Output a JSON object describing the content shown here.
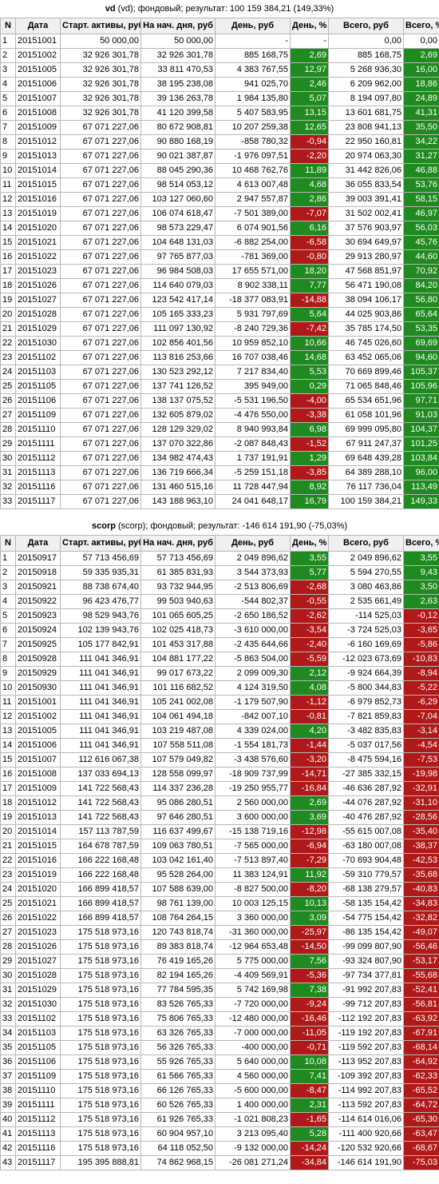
{
  "colors": {
    "positive": "#1f8a1f",
    "negative": "#b01919"
  },
  "headers": [
    "N",
    "Дата",
    "Старт. активы, руб",
    "На нач. дня, руб",
    "День, руб",
    "День, %",
    "Всего, руб",
    "Всего, %"
  ],
  "sections": [
    {
      "name": "vd",
      "title_rest": " (vd); фондовый; результат: 100 159 384,21 (149,33%)",
      "rows": [
        [
          "1",
          "20151001",
          "50 000,00",
          "50 000,00",
          "-",
          "-",
          "0,00",
          "0,00"
        ],
        [
          "2",
          "20151002",
          "32 926 301,78",
          "32 926 301,78",
          "885 168,75",
          "2,69",
          "885 168,75",
          "2,69"
        ],
        [
          "3",
          "20151005",
          "32 926 301,78",
          "33 811 470,53",
          "4 383 767,55",
          "12,97",
          "5 268 936,30",
          "16,00"
        ],
        [
          "4",
          "20151006",
          "32 926 301,78",
          "38 195 238,08",
          "941 025,70",
          "2,46",
          "6 209 962,00",
          "18,86"
        ],
        [
          "5",
          "20151007",
          "32 926 301,78",
          "39 136 263,78",
          "1 984 135,80",
          "5,07",
          "8 194 097,80",
          "24,89"
        ],
        [
          "6",
          "20151008",
          "32 926 301,78",
          "41 120 399,58",
          "5 407 583,95",
          "13,15",
          "13 601 681,75",
          "41,31"
        ],
        [
          "7",
          "20151009",
          "67 071 227,06",
          "80 672 908,81",
          "10 207 259,38",
          "12,65",
          "23 808 941,13",
          "35,50"
        ],
        [
          "8",
          "20151012",
          "67 071 227,06",
          "90 880 168,19",
          "-858 780,32",
          "-0,94",
          "22 950 160,81",
          "34,22"
        ],
        [
          "9",
          "20151013",
          "67 071 227,06",
          "90 021 387,87",
          "-1 976 097,51",
          "-2,20",
          "20 974 063,30",
          "31,27"
        ],
        [
          "10",
          "20151014",
          "67 071 227,06",
          "88 045 290,36",
          "10 468 762,76",
          "11,89",
          "31 442 826,06",
          "46,88"
        ],
        [
          "11",
          "20151015",
          "67 071 227,06",
          "98 514 053,12",
          "4 613 007,48",
          "4,68",
          "36 055 833,54",
          "53,76"
        ],
        [
          "12",
          "20151016",
          "67 071 227,06",
          "103 127 060,60",
          "2 947 557,87",
          "2,86",
          "39 003 391,41",
          "58,15"
        ],
        [
          "13",
          "20151019",
          "67 071 227,06",
          "106 074 618,47",
          "-7 501 389,00",
          "-7,07",
          "31 502 002,41",
          "46,97"
        ],
        [
          "14",
          "20151020",
          "67 071 227,06",
          "98 573 229,47",
          "6 074 901,56",
          "6,16",
          "37 576 903,97",
          "56,03"
        ],
        [
          "15",
          "20151021",
          "67 071 227,06",
          "104 648 131,03",
          "-6 882 254,00",
          "-6,58",
          "30 694 649,97",
          "45,76"
        ],
        [
          "16",
          "20151022",
          "67 071 227,06",
          "97 765 877,03",
          "-781 369,00",
          "-0,80",
          "29 913 280,97",
          "44,60"
        ],
        [
          "17",
          "20151023",
          "67 071 227,06",
          "96 984 508,03",
          "17 655 571,00",
          "18,20",
          "47 568 851,97",
          "70,92"
        ],
        [
          "18",
          "20151026",
          "67 071 227,06",
          "114 640 079,03",
          "8 902 338,11",
          "7,77",
          "56 471 190,08",
          "84,20"
        ],
        [
          "19",
          "20151027",
          "67 071 227,06",
          "123 542 417,14",
          "-18 377 083,91",
          "-14,88",
          "38 094 106,17",
          "56,80"
        ],
        [
          "20",
          "20151028",
          "67 071 227,06",
          "105 165 333,23",
          "5 931 797,69",
          "5,64",
          "44 025 903,86",
          "65,64"
        ],
        [
          "21",
          "20151029",
          "67 071 227,06",
          "111 097 130,92",
          "-8 240 729,36",
          "-7,42",
          "35 785 174,50",
          "53,35"
        ],
        [
          "22",
          "20151030",
          "67 071 227,06",
          "102 856 401,56",
          "10 959 852,10",
          "10,66",
          "46 745 026,60",
          "69,69"
        ],
        [
          "23",
          "20151102",
          "67 071 227,06",
          "113 816 253,66",
          "16 707 038,46",
          "14,68",
          "63 452 065,06",
          "94,60"
        ],
        [
          "24",
          "20151103",
          "67 071 227,06",
          "130 523 292,12",
          "7 217 834,40",
          "5,53",
          "70 669 899,46",
          "105,37"
        ],
        [
          "25",
          "20151105",
          "67 071 227,06",
          "137 741 126,52",
          "395 949,00",
          "0,29",
          "71 065 848,46",
          "105,96"
        ],
        [
          "26",
          "20151106",
          "67 071 227,06",
          "138 137 075,52",
          "-5 531 196,50",
          "-4,00",
          "65 534 651,96",
          "97,71"
        ],
        [
          "27",
          "20151109",
          "67 071 227,06",
          "132 605 879,02",
          "-4 476 550,00",
          "-3,38",
          "61 058 101,96",
          "91,03"
        ],
        [
          "28",
          "20151110",
          "67 071 227,06",
          "128 129 329,02",
          "8 940 993,84",
          "6,98",
          "69 999 095,80",
          "104,37"
        ],
        [
          "29",
          "20151111",
          "67 071 227,06",
          "137 070 322,86",
          "-2 087 848,43",
          "-1,52",
          "67 911 247,37",
          "101,25"
        ],
        [
          "30",
          "20151112",
          "67 071 227,06",
          "134 982 474,43",
          "1 737 191,91",
          "1,29",
          "69 648 439,28",
          "103,84"
        ],
        [
          "31",
          "20151113",
          "67 071 227,06",
          "136 719 666,34",
          "-5 259 151,18",
          "-3,85",
          "64 389 288,10",
          "96,00"
        ],
        [
          "32",
          "20151116",
          "67 071 227,06",
          "131 460 515,16",
          "11 728 447,94",
          "8,92",
          "76 117 736,04",
          "113,49"
        ],
        [
          "33",
          "20151117",
          "67 071 227,06",
          "143 188 963,10",
          "24 041 648,17",
          "16,79",
          "100 159 384,21",
          "149,33"
        ]
      ]
    },
    {
      "name": "scorp",
      "title_rest": " (scorp); фондовый; результат: -146 614 191,90 (-75,03%)",
      "rows": [
        [
          "1",
          "20150917",
          "57 713 456,69",
          "57 713 456,69",
          "2 049 896,62",
          "3,55",
          "2 049 896,62",
          "3,55"
        ],
        [
          "2",
          "20150918",
          "59 335 935,31",
          "61 385 831,93",
          "3 544 373,93",
          "5,77",
          "5 594 270,55",
          "9,43"
        ],
        [
          "3",
          "20150921",
          "88 738 674,40",
          "93 732 944,95",
          "-2 513 806,69",
          "-2,68",
          "3 080 463,86",
          "3,50"
        ],
        [
          "4",
          "20150922",
          "96 423 476,77",
          "99 503 940,63",
          "-544 802,37",
          "-0,55",
          "2 535 661,49",
          "2,63"
        ],
        [
          "5",
          "20150923",
          "98 529 943,76",
          "101 065 605,25",
          "-2 650 186,52",
          "-2,62",
          "-114 525,03",
          "-0,12"
        ],
        [
          "6",
          "20150924",
          "102 139 943,76",
          "102 025 418,73",
          "-3 610 000,00",
          "-3,54",
          "-3 724 525,03",
          "-3,65"
        ],
        [
          "7",
          "20150925",
          "105 177 842,91",
          "101 453 317,88",
          "-2 435 644,66",
          "-2,40",
          "-6 160 169,69",
          "-5,86"
        ],
        [
          "8",
          "20150928",
          "111 041 346,91",
          "104 881 177,22",
          "-5 863 504,00",
          "-5,59",
          "-12 023 673,69",
          "-10,83"
        ],
        [
          "9",
          "20150929",
          "111 041 346,91",
          "99 017 673,22",
          "2 099 009,30",
          "2,12",
          "-9 924 664,39",
          "-8,94"
        ],
        [
          "10",
          "20150930",
          "111 041 346,91",
          "101 116 682,52",
          "4 124 319,50",
          "4,08",
          "-5 800 344,83",
          "-5,22"
        ],
        [
          "11",
          "20151001",
          "111 041 346,91",
          "105 241 002,08",
          "-1 179 507,90",
          "-1,12",
          "-6 979 852,73",
          "-6,29"
        ],
        [
          "12",
          "20151002",
          "111 041 346,91",
          "104 061 494,18",
          "-842 007,10",
          "-0,81",
          "-7 821 859,83",
          "-7,04"
        ],
        [
          "13",
          "20151005",
          "111 041 346,91",
          "103 219 487,08",
          "4 339 024,00",
          "4,20",
          "-3 482 835,83",
          "-3,14"
        ],
        [
          "14",
          "20151006",
          "111 041 346,91",
          "107 558 511,08",
          "-1 554 181,73",
          "-1,44",
          "-5 037 017,56",
          "-4,54"
        ],
        [
          "15",
          "20151007",
          "112 616 067,38",
          "107 579 049,82",
          "-3 438 576,60",
          "-3,20",
          "-8 475 594,16",
          "-7,53"
        ],
        [
          "16",
          "20151008",
          "137 033 694,13",
          "128 558 099,97",
          "-18 909 737,99",
          "-14,71",
          "-27 385 332,15",
          "-19,98"
        ],
        [
          "17",
          "20151009",
          "141 722 568,43",
          "114 337 236,28",
          "-19 250 955,77",
          "-16,84",
          "-46 636 287,92",
          "-32,91"
        ],
        [
          "18",
          "20151012",
          "141 722 568,43",
          "95 086 280,51",
          "2 560 000,00",
          "2,69",
          "-44 076 287,92",
          "-31,10"
        ],
        [
          "19",
          "20151013",
          "141 722 568,43",
          "97 646 280,51",
          "3 600 000,00",
          "3,69",
          "-40 476 287,92",
          "-28,56"
        ],
        [
          "20",
          "20151014",
          "157 113 787,59",
          "116 637 499,67",
          "-15 138 719,16",
          "-12,98",
          "-55 615 007,08",
          "-35,40"
        ],
        [
          "21",
          "20151015",
          "164 678 787,59",
          "109 063 780,51",
          "-7 565 000,00",
          "-6,94",
          "-63 180 007,08",
          "-38,37"
        ],
        [
          "22",
          "20151016",
          "166 222 168,48",
          "103 042 161,40",
          "-7 513 897,40",
          "-7,29",
          "-70 693 904,48",
          "-42,53"
        ],
        [
          "23",
          "20151019",
          "166 222 168,48",
          "95 528 264,00",
          "11 383 124,91",
          "11,92",
          "-59 310 779,57",
          "-35,68"
        ],
        [
          "24",
          "20151020",
          "166 899 418,57",
          "107 588 639,00",
          "-8 827 500,00",
          "-8,20",
          "-68 138 279,57",
          "-40,83"
        ],
        [
          "25",
          "20151021",
          "166 899 418,57",
          "98 761 139,00",
          "10 003 125,15",
          "10,13",
          "-58 135 154,42",
          "-34,83"
        ],
        [
          "26",
          "20151022",
          "166 899 418,57",
          "108 764 264,15",
          "3 360 000,00",
          "3,09",
          "-54 775 154,42",
          "-32,82"
        ],
        [
          "27",
          "20151023",
          "175 518 973,16",
          "120 743 818,74",
          "-31 360 000,00",
          "-25,97",
          "-86 135 154,42",
          "-49,07"
        ],
        [
          "28",
          "20151026",
          "175 518 973,16",
          "89 383 818,74",
          "-12 964 653,48",
          "-14,50",
          "-99 099 807,90",
          "-56,46"
        ],
        [
          "29",
          "20151027",
          "175 518 973,16",
          "76 419 165,26",
          "5 775 000,00",
          "7,56",
          "-93 324 807,90",
          "-53,17"
        ],
        [
          "30",
          "20151028",
          "175 518 973,16",
          "82 194 165,26",
          "-4 409 569,91",
          "-5,36",
          "-97 734 377,81",
          "-55,68"
        ],
        [
          "31",
          "20151029",
          "175 518 973,16",
          "77 784 595,35",
          "5 742 169,98",
          "7,38",
          "-91 992 207,83",
          "-52,41"
        ],
        [
          "32",
          "20151030",
          "175 518 973,16",
          "83 526 765,33",
          "-7 720 000,00",
          "-9,24",
          "-99 712 207,83",
          "-56,81"
        ],
        [
          "33",
          "20151102",
          "175 518 973,16",
          "75 806 765,33",
          "-12 480 000,00",
          "-16,46",
          "-112 192 207,83",
          "-63,92"
        ],
        [
          "34",
          "20151103",
          "175 518 973,16",
          "63 326 765,33",
          "-7 000 000,00",
          "-11,05",
          "-119 192 207,83",
          "-67,91"
        ],
        [
          "35",
          "20151105",
          "175 518 973,16",
          "56 326 765,33",
          "-400 000,00",
          "-0,71",
          "-119 592 207,83",
          "-68,14"
        ],
        [
          "36",
          "20151106",
          "175 518 973,16",
          "55 926 765,33",
          "5 640 000,00",
          "10,08",
          "-113 952 207,83",
          "-64,92"
        ],
        [
          "37",
          "20151109",
          "175 518 973,16",
          "61 566 765,33",
          "4 560 000,00",
          "7,41",
          "-109 392 207,83",
          "-62,33"
        ],
        [
          "38",
          "20151110",
          "175 518 973,16",
          "66 126 765,33",
          "-5 600 000,00",
          "-8,47",
          "-114 992 207,83",
          "-65,52"
        ],
        [
          "39",
          "20151111",
          "175 518 973,16",
          "60 526 765,33",
          "1 400 000,00",
          "2,31",
          "-113 592 207,83",
          "-64,72"
        ],
        [
          "40",
          "20151112",
          "175 518 973,16",
          "61 926 765,33",
          "-1 021 808,23",
          "-1,65",
          "-114 614 016,06",
          "-65,30"
        ],
        [
          "41",
          "20151113",
          "175 518 973,16",
          "60 904 957,10",
          "3 213 095,40",
          "5,28",
          "-111 400 920,66",
          "-63,47"
        ],
        [
          "42",
          "20151116",
          "175 518 973,16",
          "64 118 052,50",
          "-9 132 000,00",
          "-14,24",
          "-120 532 920,66",
          "-68,67"
        ],
        [
          "43",
          "20151117",
          "195 395 888,81",
          "74 862 968,15",
          "-26 081 271,24",
          "-34,84",
          "-146 614 191,90",
          "-75,03"
        ]
      ]
    }
  ]
}
